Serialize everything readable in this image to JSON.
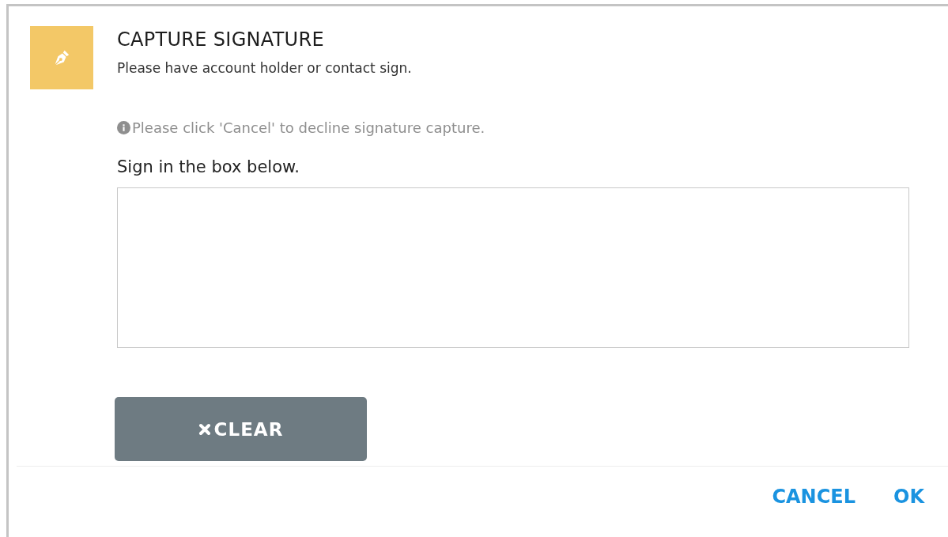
{
  "dialog": {
    "title": "CAPTURE SIGNATURE",
    "subtitle": "Please have account holder or contact sign.",
    "notice": "Please click 'Cancel' to decline signature capture.",
    "field_label": "Sign in the box below.",
    "clear_button": "CLEAR",
    "buttons": [
      "CANCEL",
      "OK"
    ]
  }
}
